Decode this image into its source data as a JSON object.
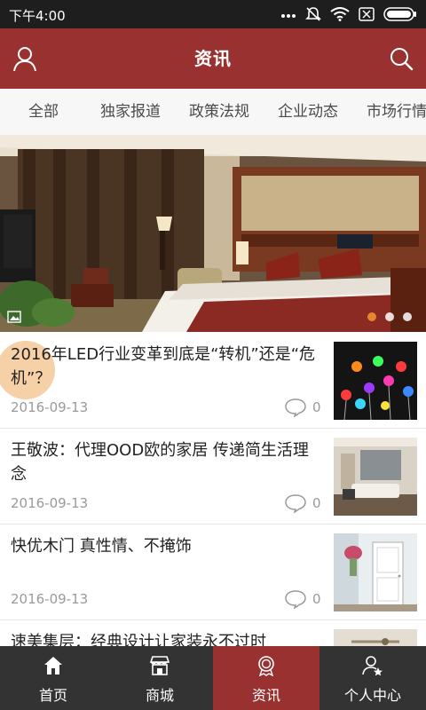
{
  "status_bar": {
    "time": "下午4:00"
  },
  "header": {
    "title": "资讯"
  },
  "tabs": [
    "全部",
    "独家报道",
    "政策法规",
    "企业动态",
    "市场行情"
  ],
  "news": [
    {
      "title": "2016年LED行业变革到底是“转机”还是“危机”？",
      "date": "2016-09-13",
      "comments": "0"
    },
    {
      "title": "王敬波：代理OOD欧的家居 传递简生活理念",
      "date": "2016-09-13",
      "comments": "0"
    },
    {
      "title": "快优木门 真性情、不掩饰",
      "date": "2016-09-13",
      "comments": "0"
    },
    {
      "title": "速美集层：经典设计让家装永不过时",
      "date": "",
      "comments": ""
    }
  ],
  "bottom_nav": [
    {
      "label": "首页",
      "icon": "home-icon"
    },
    {
      "label": "商城",
      "icon": "store-icon"
    },
    {
      "label": "资讯",
      "icon": "news-badge-icon"
    },
    {
      "label": "个人中心",
      "icon": "user-star-icon"
    }
  ],
  "colors": {
    "brand": "#993131",
    "tab_bar": "#333333",
    "active_dot": "#e8852e"
  }
}
